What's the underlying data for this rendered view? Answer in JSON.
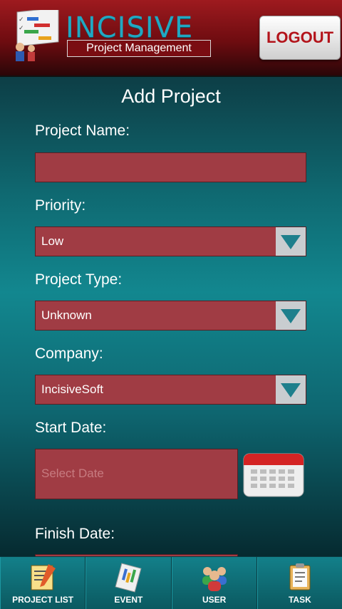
{
  "header": {
    "brand": "INCISIVE",
    "subtitle": "Project Management",
    "logout_label": "LOGOUT"
  },
  "form": {
    "title": "Add Project",
    "project_name": {
      "label": "Project Name:",
      "value": ""
    },
    "priority": {
      "label": "Priority:",
      "selected": "Low"
    },
    "project_type": {
      "label": "Project Type:",
      "selected": "Unknown"
    },
    "company": {
      "label": "Company:",
      "selected": "IncisiveSoft"
    },
    "start_date": {
      "label": "Start Date:",
      "placeholder": "Select Date"
    },
    "finish_date": {
      "label": "Finish Date:"
    }
  },
  "nav": {
    "items": [
      {
        "label": "PROJECT LIST",
        "icon": "project-list-icon"
      },
      {
        "label": "EVENT",
        "icon": "event-icon"
      },
      {
        "label": "USER",
        "icon": "user-icon"
      },
      {
        "label": "TASK",
        "icon": "task-icon"
      }
    ]
  },
  "colors": {
    "header_red": "#8e1419",
    "field_red": "#a03c44",
    "brand_blue": "#21a8c2",
    "background_teal": "#12878f"
  }
}
